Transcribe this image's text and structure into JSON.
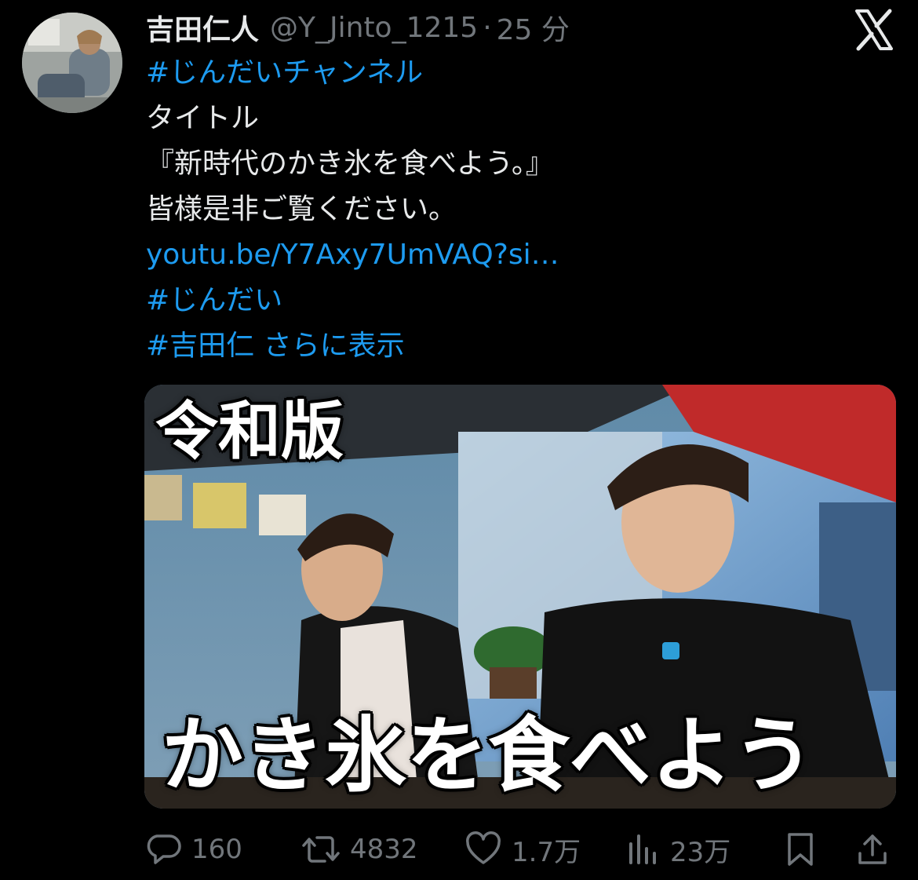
{
  "tweet": {
    "author": {
      "display_name": "吉田仁人",
      "handle": "@Y_Jinto_1215",
      "separator": "·",
      "time": "25 分"
    },
    "text_lines": [
      {
        "text": "#じんだいチャンネル",
        "kind": "hashtag"
      },
      {
        "text": "タイトル",
        "kind": "text"
      },
      {
        "text": "『新時代のかき氷を食べよう。』",
        "kind": "text"
      },
      {
        "text": "皆様是非ご覧ください。",
        "kind": "text"
      },
      {
        "text": "youtu.be/Y7Axy7UmVAQ?si…",
        "kind": "link"
      },
      {
        "text": "#じんだい",
        "kind": "hashtag"
      },
      {
        "text": "#吉田仁",
        "kind": "hashtag"
      }
    ],
    "show_more": "さらに表示",
    "media": {
      "overlay_top": "令和版",
      "overlay_bottom": "かき氷を食べよう"
    },
    "actions": {
      "replies": "160",
      "reposts": "4832",
      "likes": "1.7万",
      "views": "23万"
    },
    "icons": {
      "brand": "x-logo-icon",
      "reply": "reply-icon",
      "repost": "repost-icon",
      "like": "heart-icon",
      "views": "views-icon",
      "bookmark": "bookmark-icon",
      "share": "share-icon"
    },
    "colors": {
      "background": "#000000",
      "text": "#e7e9ea",
      "secondary": "#71767b",
      "link": "#1d9bf0"
    }
  }
}
